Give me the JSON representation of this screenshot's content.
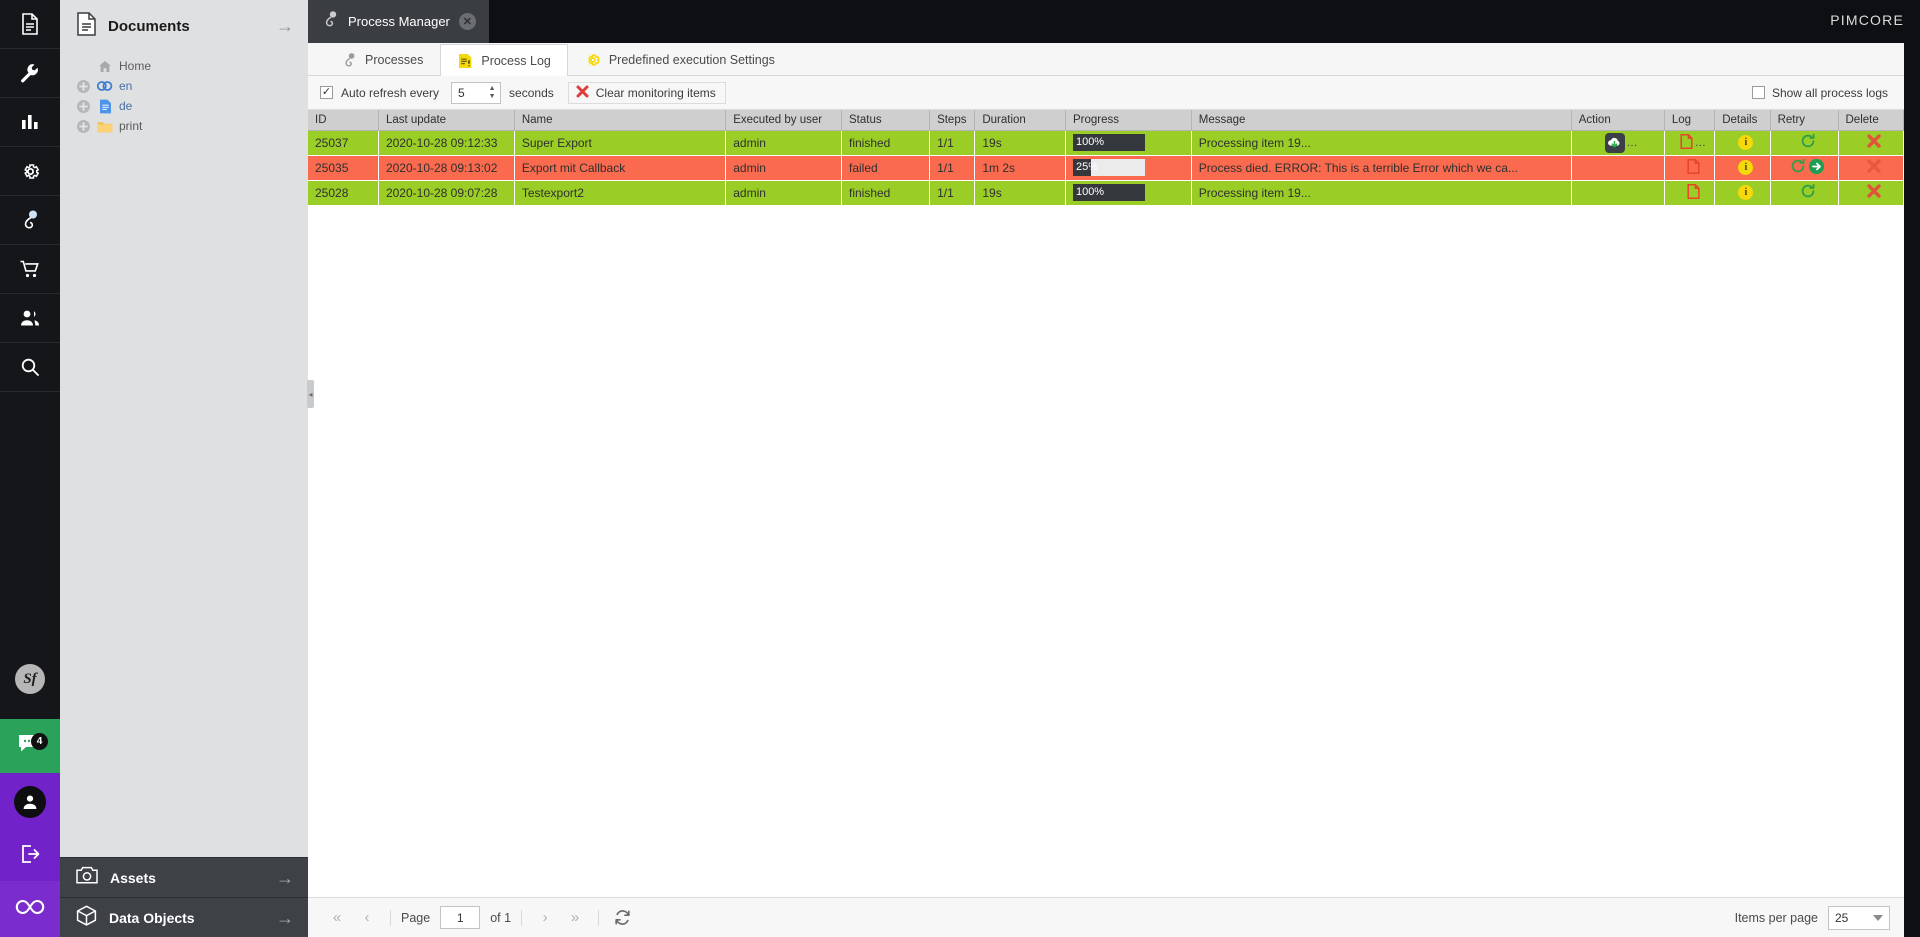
{
  "rail": {
    "items": [
      {
        "name": "documents-icon",
        "title": "Documents"
      },
      {
        "name": "tools-icon",
        "title": "Tools"
      },
      {
        "name": "reports-icon",
        "title": "Reports"
      },
      {
        "name": "settings-icon",
        "title": "Settings"
      },
      {
        "name": "marketing-icon",
        "title": "Marketing"
      },
      {
        "name": "ecommerce-icon",
        "title": "E-Commerce"
      },
      {
        "name": "customers-icon",
        "title": "Customers"
      },
      {
        "name": "search-icon",
        "title": "Search"
      }
    ],
    "symfony_label": "Sf",
    "notification_badge": "4"
  },
  "tree": {
    "title": "Documents",
    "nodes": [
      {
        "label": "Home",
        "icon": "home-icon",
        "expandable": false,
        "kind": "home"
      },
      {
        "label": "en",
        "icon": "link-icon",
        "expandable": true,
        "kind": "link"
      },
      {
        "label": "de",
        "icon": "page-icon",
        "expandable": true,
        "kind": "doc"
      },
      {
        "label": "print",
        "icon": "folder-icon",
        "expandable": true,
        "kind": "folder"
      }
    ],
    "footer": [
      {
        "label": "Assets",
        "icon": "camera-icon"
      },
      {
        "label": "Data Objects",
        "icon": "cube-icon"
      }
    ]
  },
  "window": {
    "tab_label": "Process Manager",
    "tab_icon": "process-manager-icon",
    "close_icon": "close-icon",
    "brand": "PIMCORE"
  },
  "tabs": [
    {
      "label": "Processes",
      "icon": "process-icon",
      "active": false
    },
    {
      "label": "Process Log",
      "icon": "log-icon",
      "active": true
    },
    {
      "label": "Predefined execution Settings",
      "icon": "gear-icon",
      "active": false
    }
  ],
  "toolbar": {
    "auto_refresh_checked": true,
    "auto_refresh_label": "Auto refresh every",
    "interval_value": "5",
    "seconds_label": "seconds",
    "clear_label": "Clear monitoring items",
    "clear_icon": "red-x-icon",
    "show_all_label": "Show all process logs",
    "show_all_checked": false
  },
  "grid": {
    "columns": [
      {
        "key": "id",
        "label": "ID"
      },
      {
        "key": "last_update",
        "label": "Last update"
      },
      {
        "key": "name",
        "label": "Name"
      },
      {
        "key": "executed_by_user",
        "label": "Executed by user"
      },
      {
        "key": "status",
        "label": "Status"
      },
      {
        "key": "steps",
        "label": "Steps"
      },
      {
        "key": "duration",
        "label": "Duration"
      },
      {
        "key": "progress",
        "label": "Progress"
      },
      {
        "key": "message",
        "label": "Message"
      },
      {
        "key": "action",
        "label": "Action"
      },
      {
        "key": "log",
        "label": "Log"
      },
      {
        "key": "details",
        "label": "Details"
      },
      {
        "key": "retry",
        "label": "Retry"
      },
      {
        "key": "delete",
        "label": "Delete"
      }
    ],
    "rows": [
      {
        "id": "25037",
        "last_update": "2020-10-28 09:12:33",
        "name": "Super Export",
        "executed_by_user": "admin",
        "status": "finished",
        "steps": "1/1",
        "duration": "19s",
        "progress_label": "100%",
        "progress_value": 100,
        "message": "Processing item 19...",
        "state": "ok",
        "has_download": true,
        "download_dots": "...",
        "has_log": true,
        "log_dots": "...",
        "details_label": "i",
        "has_retry": true,
        "has_retry_run": false,
        "has_delete": true
      },
      {
        "id": "25035",
        "last_update": "2020-10-28 09:13:02",
        "name": "Export mit Callback",
        "executed_by_user": "admin",
        "status": "failed",
        "steps": "1/1",
        "duration": "1m 2s",
        "progress_label": "25%",
        "progress_value": 25,
        "message": "Process died. ERROR: This is a terrible Error which we ca...",
        "state": "fail",
        "has_download": false,
        "download_dots": "",
        "has_log": true,
        "log_dots": "",
        "details_label": "i",
        "has_retry": true,
        "has_retry_run": true,
        "has_delete": true
      },
      {
        "id": "25028",
        "last_update": "2020-10-28 09:07:28",
        "name": "Testexport2",
        "executed_by_user": "admin",
        "status": "finished",
        "steps": "1/1",
        "duration": "19s",
        "progress_label": "100%",
        "progress_value": 100,
        "message": "Processing item 19...",
        "state": "ok",
        "has_download": false,
        "download_dots": "",
        "has_log": true,
        "log_dots": "",
        "details_label": "i",
        "has_retry": true,
        "has_retry_run": false,
        "has_delete": true
      }
    ]
  },
  "pager": {
    "first_icon": "«",
    "prev_icon": "‹",
    "page_label": "Page",
    "page_value": "1",
    "of_label": "of 1",
    "next_icon": "›",
    "last_icon": "»",
    "refresh_icon": "refresh-icon",
    "items_per_page_label": "Items per page",
    "items_per_page_value": "25"
  },
  "colors": {
    "row_ok": "#9ace26",
    "row_fail": "#fa6a4e",
    "progress_fill": "#34383d",
    "accent_purple": "#7122c9",
    "accent_green": "#2aa259"
  }
}
